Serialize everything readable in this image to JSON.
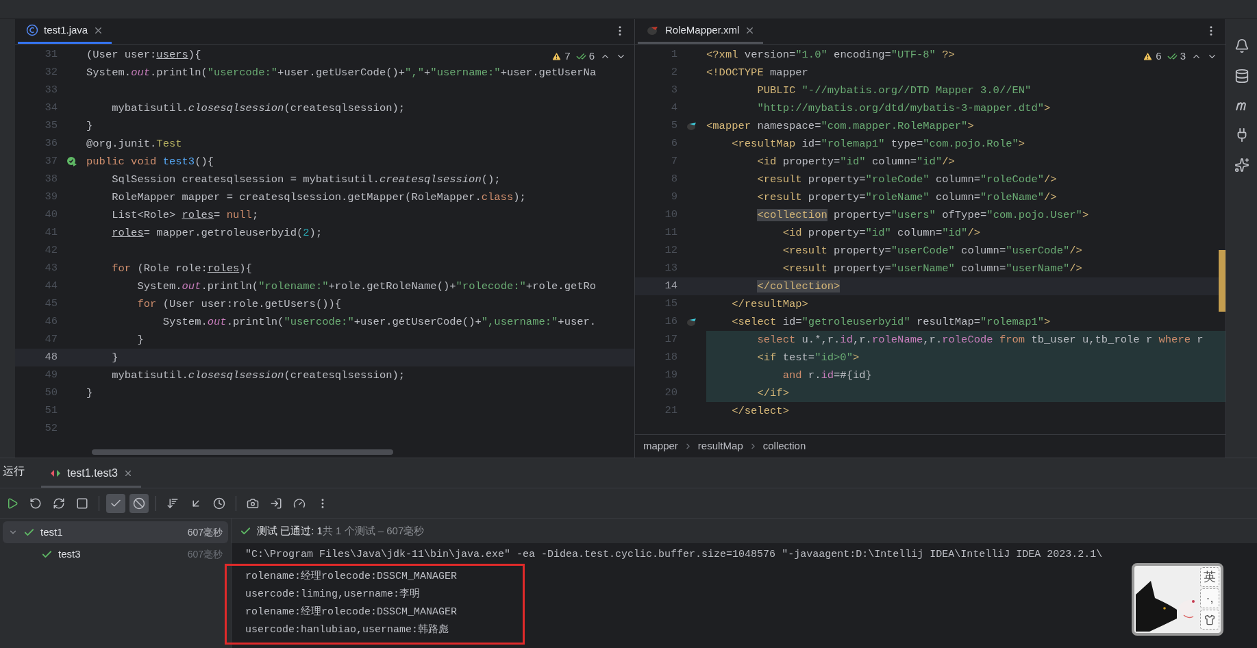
{
  "left_editor": {
    "tab": {
      "label": "test1.java",
      "selected": true
    },
    "inspections": {
      "warnings": "7",
      "weak_warnings": "6"
    },
    "lines": [
      {
        "number": "31",
        "current": false,
        "tokens": [
          {
            "text": "(User user:"
          },
          {
            "text": "users",
            "kind": "underlined"
          },
          {
            "text": "){"
          }
        ]
      },
      {
        "number": "32",
        "current": false,
        "tokens": [
          {
            "text": "System."
          },
          {
            "text": "out",
            "kind": "field"
          },
          {
            "text": ".println("
          },
          {
            "text": "\"usercode:\"",
            "kind": "string"
          },
          {
            "text": "+user.getUserCode()+"
          },
          {
            "text": "\",\"",
            "kind": "string"
          },
          {
            "text": "+"
          },
          {
            "text": "\"username:\"",
            "kind": "string"
          },
          {
            "text": "+user.getUserNa"
          }
        ]
      },
      {
        "number": "33",
        "current": false
      },
      {
        "number": "34",
        "current": false,
        "tokens": [
          {
            "text": "    mybatisutil."
          },
          {
            "text": "closesqlsession",
            "kind": "static"
          },
          {
            "text": "(createsqlsession);"
          }
        ]
      },
      {
        "number": "35",
        "current": false,
        "tokens": [
          {
            "text": "}"
          }
        ]
      },
      {
        "number": "36",
        "current": false,
        "tokens": [
          {
            "text": "@org.junit."
          },
          {
            "text": "Test",
            "kind": "annotation"
          }
        ]
      },
      {
        "number": "37",
        "current": false,
        "kind": "run",
        "tokens": [
          {
            "text": "public void ",
            "kind": "keyword"
          },
          {
            "text": "test3",
            "kind": "function"
          },
          {
            "text": "(){"
          }
        ]
      },
      {
        "number": "38",
        "current": false,
        "tokens": [
          {
            "text": "    SqlSession createsqlsession = mybatisutil."
          },
          {
            "text": "createsqlsession",
            "kind": "static"
          },
          {
            "text": "();"
          }
        ]
      },
      {
        "number": "39",
        "current": false,
        "tokens": [
          {
            "text": "    RoleMapper mapper = createsqlsession.getMapper(RoleMapper."
          },
          {
            "text": "class",
            "kind": "keyword"
          },
          {
            "text": ");"
          }
        ]
      },
      {
        "number": "40",
        "current": false,
        "tokens": [
          {
            "text": "    List<Role> "
          },
          {
            "text": "roles",
            "kind": "underlined"
          },
          {
            "text": "= "
          },
          {
            "text": "null",
            "kind": "keyword"
          },
          {
            "text": ";"
          }
        ]
      },
      {
        "number": "41",
        "current": false,
        "tokens": [
          {
            "text": "    roles",
            "kind": "underlined"
          },
          {
            "text": "= mapper.getroleuserbyid("
          },
          {
            "text": "2",
            "kind": "number"
          },
          {
            "text": ");"
          }
        ]
      },
      {
        "number": "42",
        "current": false
      },
      {
        "number": "43",
        "current": false,
        "tokens": [
          {
            "text": "    for ",
            "kind": "keyword"
          },
          {
            "text": "(Role role:"
          },
          {
            "text": "roles",
            "kind": "underlined"
          },
          {
            "text": "){"
          }
        ]
      },
      {
        "number": "44",
        "current": false,
        "tokens": [
          {
            "text": "        System."
          },
          {
            "text": "out",
            "kind": "field"
          },
          {
            "text": ".println("
          },
          {
            "text": "\"rolename:\"",
            "kind": "string"
          },
          {
            "text": "+role.getRoleName()+"
          },
          {
            "text": "\"rolecode:\"",
            "kind": "string"
          },
          {
            "text": "+role.getRo"
          }
        ]
      },
      {
        "number": "45",
        "current": false,
        "tokens": [
          {
            "text": "        for ",
            "kind": "keyword"
          },
          {
            "text": "(User user:role.getUsers()){"
          }
        ]
      },
      {
        "number": "46",
        "current": false,
        "tokens": [
          {
            "text": "            System."
          },
          {
            "text": "out",
            "kind": "field"
          },
          {
            "text": ".println("
          },
          {
            "text": "\"usercode:\"",
            "kind": "string"
          },
          {
            "text": "+user.getUserCode()+"
          },
          {
            "text": "\",username:\"",
            "kind": "string"
          },
          {
            "text": "+user."
          }
        ]
      },
      {
        "number": "47",
        "current": false,
        "tokens": [
          {
            "text": "        }"
          }
        ]
      },
      {
        "number": "48",
        "current": true,
        "tokens": [
          {
            "text": "    }"
          }
        ]
      },
      {
        "number": "49",
        "current": false,
        "tokens": [
          {
            "text": "    mybatisutil."
          },
          {
            "text": "closesqlsession",
            "kind": "static"
          },
          {
            "text": "(createsqlsession);"
          }
        ]
      },
      {
        "number": "50",
        "current": false,
        "tokens": [
          {
            "text": "}"
          }
        ]
      },
      {
        "number": "51",
        "current": false
      },
      {
        "number": "52",
        "current": false
      }
    ]
  },
  "right_editor": {
    "tab": {
      "label": "RoleMapper.xml",
      "selected": false
    },
    "inspections": {
      "warnings": "6",
      "weak_warnings": "3"
    },
    "lines": [
      {
        "number": "1",
        "current": false,
        "fragment": false,
        "tokens": [
          {
            "text": "<?xml",
            "kind": "tag"
          },
          {
            "text": " version="
          },
          {
            "text": "\"1.0\"",
            "kind": "string"
          },
          {
            "text": " encoding="
          },
          {
            "text": "\"UTF-8\"",
            "kind": "string"
          },
          {
            "text": " ?>",
            "kind": "tag"
          }
        ]
      },
      {
        "number": "2",
        "current": false,
        "fragment": false,
        "tokens": [
          {
            "text": "<!DOCTYPE",
            "kind": "tag"
          },
          {
            "text": " mapper"
          }
        ]
      },
      {
        "number": "3",
        "current": false,
        "fragment": false,
        "tokens": [
          {
            "text": "        PUBLIC",
            "kind": "tag"
          },
          {
            "text": " \"-//mybatis.org//DTD Mapper 3.0//EN\"",
            "kind": "string"
          }
        ]
      },
      {
        "number": "4",
        "current": false,
        "fragment": false,
        "tokens": [
          {
            "text": "        \"http://mybatis.org/dtd/mybatis-3-mapper.dtd\"",
            "kind": "string"
          },
          {
            "text": ">",
            "kind": "tag"
          }
        ]
      },
      {
        "number": "5",
        "current": false,
        "fragment": false,
        "kind": "mapper",
        "tokens": [
          {
            "text": "<mapper",
            "kind": "tag"
          },
          {
            "text": " namespace="
          },
          {
            "text": "\"com.mapper.RoleMapper\"",
            "kind": "string"
          },
          {
            "text": ">",
            "kind": "tag"
          }
        ]
      },
      {
        "number": "6",
        "current": false,
        "fragment": false,
        "tokens": [
          {
            "text": "    <resultMap",
            "kind": "tag"
          },
          {
            "text": " id="
          },
          {
            "text": "\"rolemap1\"",
            "kind": "string"
          },
          {
            "text": " type="
          },
          {
            "text": "\"com.pojo.Role\"",
            "kind": "string"
          },
          {
            "text": ">",
            "kind": "tag"
          }
        ]
      },
      {
        "number": "7",
        "current": false,
        "fragment": false,
        "tokens": [
          {
            "text": "        <id",
            "kind": "tag"
          },
          {
            "text": " property="
          },
          {
            "text": "\"id\"",
            "kind": "string"
          },
          {
            "text": " column="
          },
          {
            "text": "\"id\"",
            "kind": "string"
          },
          {
            "text": "/>",
            "kind": "tag"
          }
        ]
      },
      {
        "number": "8",
        "current": false,
        "fragment": false,
        "tokens": [
          {
            "text": "        <result",
            "kind": "tag"
          },
          {
            "text": " property="
          },
          {
            "text": "\"roleCode\"",
            "kind": "string"
          },
          {
            "text": " column="
          },
          {
            "text": "\"roleCode\"",
            "kind": "string"
          },
          {
            "text": "/>",
            "kind": "tag"
          }
        ]
      },
      {
        "number": "9",
        "current": false,
        "fragment": false,
        "tokens": [
          {
            "text": "        <result",
            "kind": "tag"
          },
          {
            "text": " property="
          },
          {
            "text": "\"roleName\"",
            "kind": "string"
          },
          {
            "text": " column="
          },
          {
            "text": "\"roleName\"",
            "kind": "string"
          },
          {
            "text": "/>",
            "kind": "tag"
          }
        ]
      },
      {
        "number": "10",
        "current": false,
        "fragment": false,
        "tokens": [
          {
            "text": "        <collection",
            "kind": "matched-tag"
          },
          {
            "text": " property="
          },
          {
            "text": "\"users\"",
            "kind": "string"
          },
          {
            "text": " ofType="
          },
          {
            "text": "\"com.pojo.User\"",
            "kind": "string"
          },
          {
            "text": ">",
            "kind": "tag"
          }
        ]
      },
      {
        "number": "11",
        "current": false,
        "fragment": false,
        "tokens": [
          {
            "text": "            <id",
            "kind": "tag"
          },
          {
            "text": " property="
          },
          {
            "text": "\"id\"",
            "kind": "string"
          },
          {
            "text": " column="
          },
          {
            "text": "\"id\"",
            "kind": "string"
          },
          {
            "text": "/>",
            "kind": "tag"
          }
        ]
      },
      {
        "number": "12",
        "current": false,
        "fragment": false,
        "tokens": [
          {
            "text": "            <result",
            "kind": "tag"
          },
          {
            "text": " property="
          },
          {
            "text": "\"userCode\"",
            "kind": "string"
          },
          {
            "text": " column="
          },
          {
            "text": "\"userCode\"",
            "kind": "string"
          },
          {
            "text": "/>",
            "kind": "tag"
          }
        ]
      },
      {
        "number": "13",
        "current": false,
        "fragment": false,
        "tokens": [
          {
            "text": "            <result",
            "kind": "tag"
          },
          {
            "text": " property="
          },
          {
            "text": "\"userName\"",
            "kind": "string"
          },
          {
            "text": " column="
          },
          {
            "text": "\"userName\"",
            "kind": "string"
          },
          {
            "text": "/>",
            "kind": "tag"
          }
        ]
      },
      {
        "number": "14",
        "current": true,
        "fragment": false,
        "tokens": [
          {
            "text": "        </collection>",
            "kind": "matched-tag"
          }
        ]
      },
      {
        "number": "15",
        "current": false,
        "fragment": false,
        "tokens": [
          {
            "text": "    </resultMap>",
            "kind": "tag"
          }
        ]
      },
      {
        "number": "16",
        "current": false,
        "fragment": false,
        "kind": "mapper",
        "tokens": [
          {
            "text": "    <select",
            "kind": "tag"
          },
          {
            "text": " id="
          },
          {
            "text": "\"getroleuserbyid\"",
            "kind": "string"
          },
          {
            "text": " resultMap="
          },
          {
            "text": "\"rolemap1\"",
            "kind": "string"
          },
          {
            "text": ">",
            "kind": "tag"
          }
        ]
      },
      {
        "number": "17",
        "current": false,
        "fragment": true,
        "tokens": [
          {
            "text": "        select",
            "kind": "keyword"
          },
          {
            "text": " u.*,r."
          },
          {
            "text": "id",
            "kind": "column"
          },
          {
            "text": ",r."
          },
          {
            "text": "roleName",
            "kind": "column"
          },
          {
            "text": ",r."
          },
          {
            "text": "roleCode",
            "kind": "column"
          },
          {
            "text": " from",
            "kind": "keyword"
          },
          {
            "text": " tb_user u,tb_role r "
          },
          {
            "text": "where",
            "kind": "keyword"
          },
          {
            "text": " r"
          }
        ]
      },
      {
        "number": "18",
        "current": false,
        "fragment": true,
        "tokens": [
          {
            "text": "        <if",
            "kind": "tag"
          },
          {
            "text": " test="
          },
          {
            "text": "\"id>0\"",
            "kind": "string"
          },
          {
            "text": ">",
            "kind": "tag"
          }
        ]
      },
      {
        "number": "19",
        "current": false,
        "fragment": true,
        "tokens": [
          {
            "text": "            and",
            "kind": "keyword"
          },
          {
            "text": " r."
          },
          {
            "text": "id",
            "kind": "column"
          },
          {
            "text": "=#{id}"
          }
        ]
      },
      {
        "number": "20",
        "current": false,
        "fragment": true,
        "tokens": [
          {
            "text": "        </if>",
            "kind": "tag"
          }
        ]
      },
      {
        "number": "21",
        "current": false,
        "fragment": false,
        "tokens": [
          {
            "text": "    </select>",
            "kind": "tag"
          }
        ]
      }
    ],
    "breadcrumb": [
      "mapper",
      "resultMap",
      "collection"
    ]
  },
  "run_panel": {
    "title": "运行",
    "tabs": [
      {
        "label": "test1.test3",
        "selected": true
      }
    ],
    "toolbar": [
      {
        "kind": "rerun",
        "on": false
      },
      {
        "kind": "rerun-failed",
        "on": false
      },
      {
        "kind": "toggle-auto",
        "on": false
      },
      {
        "kind": "stop",
        "on": false
      },
      {
        "kind": "separator"
      },
      {
        "kind": "passed",
        "on": true
      },
      {
        "kind": "ignored",
        "on": true
      },
      {
        "kind": "separator"
      },
      {
        "kind": "sort",
        "on": false
      },
      {
        "kind": "collapse",
        "on": false
      },
      {
        "kind": "history",
        "on": false
      },
      {
        "kind": "separator"
      },
      {
        "kind": "camera",
        "on": false
      },
      {
        "kind": "import",
        "on": false
      },
      {
        "kind": "gauge",
        "on": false
      },
      {
        "kind": "more",
        "on": false
      }
    ],
    "tree": [
      {
        "label": "test1",
        "time": "607毫秒",
        "passed": true,
        "selected": true,
        "expanded": true,
        "children": [
          {
            "label": "test3",
            "time": "607毫秒",
            "passed": true,
            "selected": false
          }
        ]
      }
    ],
    "status": {
      "passed": true,
      "label": "测试 已通过: 1",
      "summary": "共 1 个测试 – 607毫秒"
    },
    "console": [
      "\"C:\\Program Files\\Java\\jdk-11\\bin\\java.exe\" -ea -Didea.test.cyclic.buffer.size=1048576 \"-javaagent:D:\\Intellij IDEA\\IntelliJ IDEA 2023.2.1\\",
      "rolename:经理rolecode:DSSCM_MANAGER",
      "usercode:liming,username:李明",
      "rolename:经理rolecode:DSSCM_MANAGER",
      "usercode:hanlubiao,username:韩路彪"
    ]
  },
  "ime_toolbar": {
    "buttons": [
      "英",
      "·,"
    ]
  }
}
